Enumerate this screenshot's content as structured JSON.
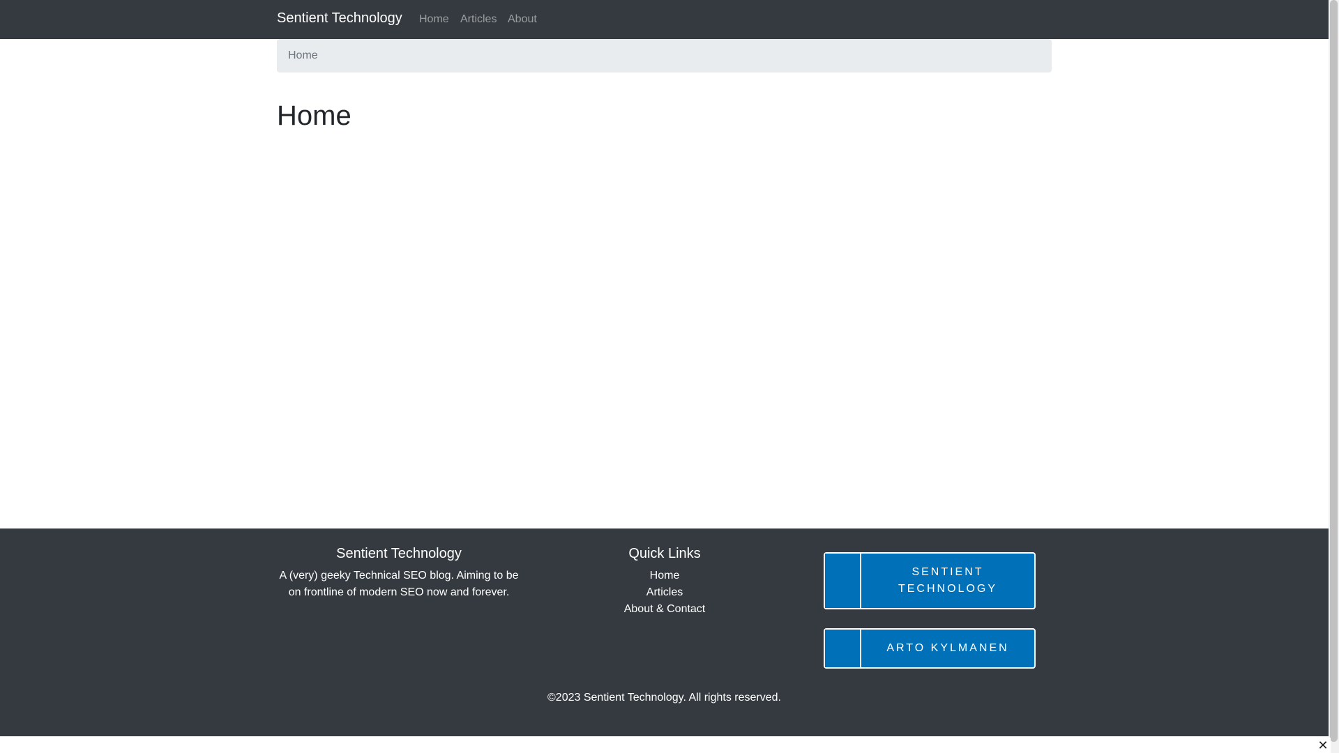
{
  "navbar": {
    "brand": "Sentient Technology",
    "links": [
      "Home",
      "Articles",
      "About"
    ]
  },
  "breadcrumb": {
    "current": "Home"
  },
  "main": {
    "title": "Home"
  },
  "footer": {
    "about": {
      "heading": "Sentient Technology",
      "text": "A (very) geeky Technical SEO blog. Aiming to be on frontline of modern SEO now and forever."
    },
    "quick_links": {
      "heading": "Quick Links",
      "items": [
        "Home",
        "Articles",
        "About & Contact"
      ]
    },
    "badges": [
      "SENTIENT TECHNOLOGY",
      "ARTO KYLMANEN"
    ],
    "copyright": "©2023 Sentient Technology. All rights reserved."
  },
  "overlay": {
    "close_glyph": "✕"
  },
  "colors": {
    "navbar_bg": "#343a40",
    "breadcrumb_bg": "#e9ecef",
    "badge_blue": "#0070b8"
  }
}
